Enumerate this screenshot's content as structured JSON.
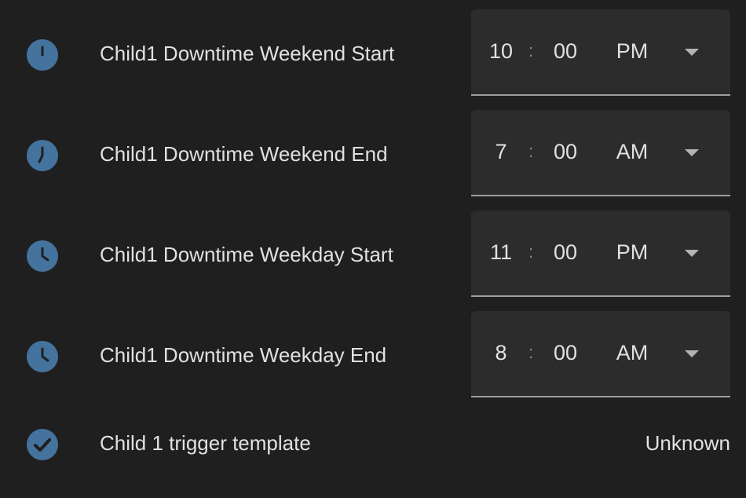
{
  "colors": {
    "background": "#1f1f1f",
    "icon_background": "#44739e",
    "icon_foreground": "#1f1f1f",
    "field_background": "#2c2c2c",
    "text": "#e1e1e1"
  },
  "entities": [
    {
      "icon": "clock-twelve-icon",
      "name": "Child1 Downtime Weekend Start",
      "time": {
        "hour": "10",
        "separator": ":",
        "minute": "00",
        "period": "PM"
      }
    },
    {
      "icon": "clock-seven-icon",
      "name": "Child1 Downtime Weekend End",
      "time": {
        "hour": "7",
        "separator": ":",
        "minute": "00",
        "period": "AM"
      }
    },
    {
      "icon": "clock-eleven-icon",
      "name": "Child1 Downtime Weekday Start",
      "time": {
        "hour": "11",
        "separator": ":",
        "minute": "00",
        "period": "PM"
      }
    },
    {
      "icon": "clock-eight-icon",
      "name": "Child1 Downtime Weekday End",
      "time": {
        "hour": "8",
        "separator": ":",
        "minute": "00",
        "period": "AM"
      }
    },
    {
      "icon": "check-icon",
      "name": "Child 1 trigger template",
      "state": "Unknown"
    }
  ]
}
